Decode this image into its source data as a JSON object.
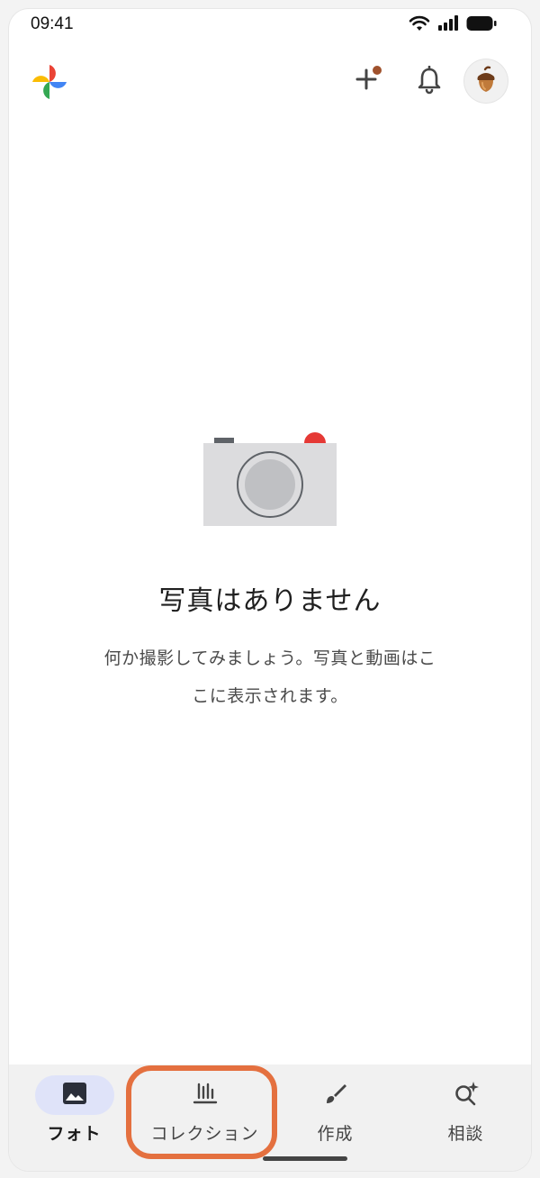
{
  "status_bar": {
    "time": "09:41",
    "icons": [
      "wifi-icon",
      "cellular-signal-icon",
      "battery-icon"
    ]
  },
  "header": {
    "logo": "photos-pinwheel-logo",
    "actions": [
      {
        "name": "add-icon",
        "badge_color": "#a0522d"
      },
      {
        "name": "bell-icon"
      }
    ],
    "avatar": "acorn-avatar-icon"
  },
  "empty_state": {
    "illustration": "camera-icon",
    "title": "写真はありません",
    "body_line1": "何か撮影してみましょう。写真と動画はこ",
    "body_line2": "こに表示されます。"
  },
  "bottom_nav": {
    "items": [
      {
        "label": "フォト",
        "icon": "photo-icon",
        "active": true
      },
      {
        "label": "コレクション",
        "icon": "collections-icon",
        "active": false
      },
      {
        "label": "作成",
        "icon": "brush-icon",
        "active": false
      },
      {
        "label": "相談",
        "icon": "ask-sparkle-search-icon",
        "active": false
      }
    ]
  },
  "colors": {
    "active_tab_bg": "#dfe3f9",
    "highlight": "#e4703f",
    "camera_body": "#dcdcde",
    "camera_shutter": "#e53935"
  }
}
